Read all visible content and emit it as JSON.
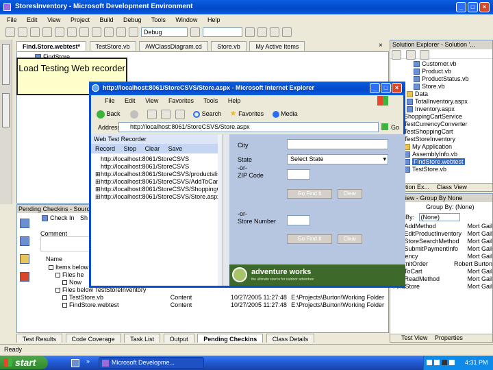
{
  "vs": {
    "title": "StoresInventory - Microsoft Development Environment",
    "menu": [
      "File",
      "Edit",
      "View",
      "Project",
      "Build",
      "Debug",
      "Tools",
      "Window",
      "Help"
    ],
    "debug_config": "Debug",
    "tabs": [
      "Find.Store.webtest*",
      "TestStore.vb",
      "AWClassDiagram.cd",
      "Store.vb",
      "My Active Items"
    ],
    "doc_header": "FindStore",
    "pending_title": "Pending Checkins - Source Files - Workspace",
    "pending_toolbar": [
      "Check In",
      "Sh"
    ],
    "comment_label": "Comment",
    "name_header": "Name",
    "pending_rows": [
      {
        "name": "Items below",
        "change": "",
        "date": "",
        "folder": ""
      },
      {
        "name": "Files he",
        "change": "",
        "date": "",
        "folder": ""
      },
      {
        "name": "Now",
        "change": "",
        "date": "",
        "folder": ""
      },
      {
        "name": "Files below TestStoreInventory",
        "change": "",
        "date": "",
        "folder": ""
      },
      {
        "name": "TestStore.vb",
        "change": "Content",
        "date": "10/27/2005 11:27:48",
        "folder": "E:\\Projects\\Burton\\Working Folder"
      },
      {
        "name": "FindStore.webtest",
        "change": "Content",
        "date": "10/27/2005 11:27:48",
        "folder": "E:\\Projects\\Burton\\Working Folder"
      }
    ],
    "bottom_tabs": [
      "Test Results",
      "Code Coverage",
      "Task List",
      "Output",
      "Pending Checkins",
      "Class Details"
    ],
    "status": "Ready"
  },
  "solution": {
    "title": "Solution Explorer - Solution '...",
    "items": [
      "Customer.vb",
      "Product.vb",
      "ProductStatus.vb",
      "Store.vb",
      "Data",
      "TotalInventory.aspx",
      "Inventory.aspx",
      "ShoppingCartService",
      "TestCurrencyConverter",
      "TestShoppingCart",
      "TestStoreInventory",
      "My Application",
      "AssemblyInfo.vb",
      "FindStore.webtest",
      "TestStore.vb"
    ],
    "tabs": [
      "Solution Ex...",
      "Class View"
    ]
  },
  "properties": {
    "title": "View - Group By None",
    "group_by": "Group By: (None)",
    "filter_label": "By:",
    "filter_value": "(None)",
    "rows": [
      {
        "a": "TestAddMethod",
        "b": "Mort Gail"
      },
      {
        "a": "TestEditProductInventory",
        "b": "Mort Gail"
      },
      {
        "a": "TestStoreSearchMethod",
        "b": "Mort Gail"
      },
      {
        "a": "TestSubmitPaymentInfo",
        "b": "Mort Gail"
      },
      {
        "a": "Currency",
        "b": "Mort Gail"
      },
      {
        "a": "SubmitOrder",
        "b": "Robert Burton"
      },
      {
        "a": "AddToCart",
        "b": "Mort Gail"
      },
      {
        "a": "TestReadMethod",
        "b": "Mort Gail"
      },
      {
        "a": "FindStore",
        "b": "Mort Gail"
      }
    ],
    "tabs": [
      "Test View",
      "Properties"
    ]
  },
  "callout": {
    "text": "Load Testing Web recorder"
  },
  "ie": {
    "title": "http://localhost:8061/StoreCSVS/Store.aspx - Microsoft Internet Explorer",
    "menu": [
      "File",
      "Edit",
      "View",
      "Favorites",
      "Tools",
      "Help"
    ],
    "nav": {
      "back": "Back",
      "search": "Search",
      "favorites": "Favorites",
      "media": "Media"
    },
    "address_label": "Address",
    "address": "http://localhost:8061/StoreCSVS/Store.aspx",
    "go": "Go",
    "recorder": {
      "title": "Web Test Recorder",
      "buttons": [
        "Record",
        "Stop",
        "Clear",
        "Save"
      ],
      "urls": [
        "http://localhost:8061/StoreCSVS",
        "http://localhost:8061/StoreCSVS",
        "http://localhost:8061/StoreCSVS/productslist.aspx",
        "http://localhost:8061/StoreCSVS/AddToCart.aspx",
        "http://localhost:8061/StoreCSVS/ShoppingCart.aspx",
        "http://localhost:8061/StoreCSVS/Store.aspx"
      ]
    },
    "form": {
      "city_label": "City",
      "state_label": "State",
      "or1": "-or-",
      "zip_label": "ZIP Code",
      "state_value": "Select State",
      "find_btn": "Go Find It",
      "clear_btn": "Clear",
      "or2": "-or-",
      "store_label": "Store Number",
      "find_btn2": "Go Find It",
      "clear_btn2": "Clear"
    },
    "brand": "adventure works",
    "brand_sub": "the ultimate source for outdoor adventure"
  },
  "taskbar": {
    "start": "start",
    "app": "Microsoft Developme...",
    "clock": "4:31 PM"
  }
}
